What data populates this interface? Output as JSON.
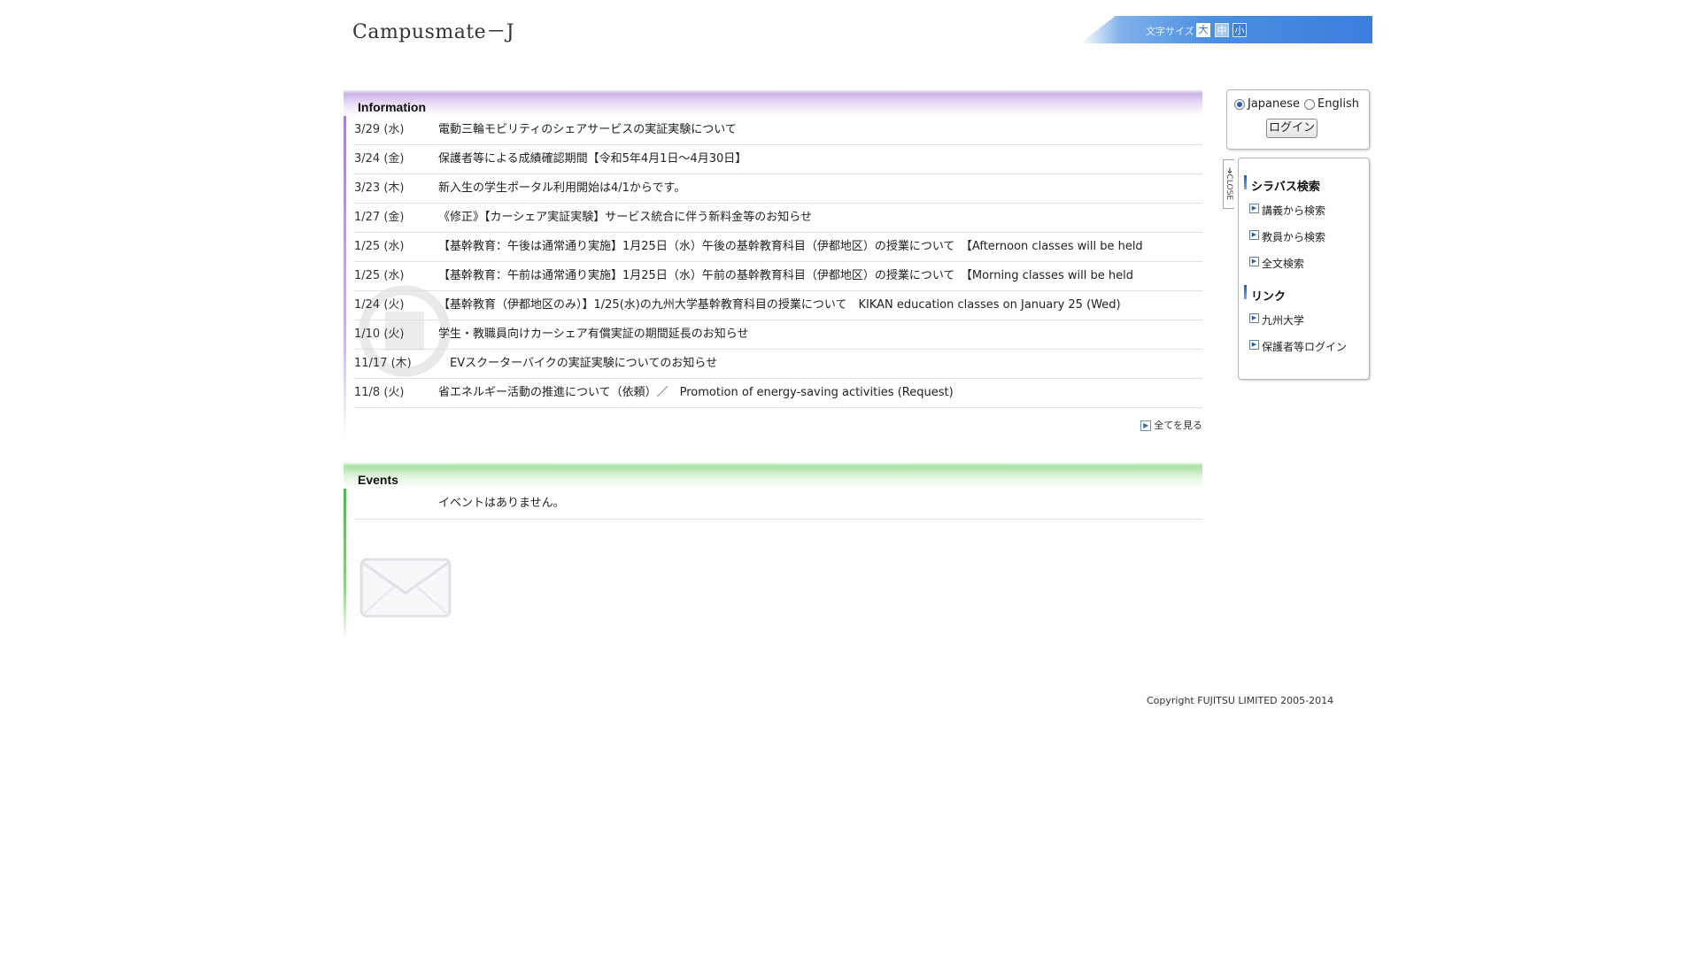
{
  "header": {
    "logo": "Campusmate－J",
    "font_size_label": "文字サイズ",
    "font_size_large": "大",
    "font_size_medium": "中",
    "font_size_small": "小"
  },
  "information": {
    "title": "Information",
    "items": [
      {
        "date": "3/29 (水)",
        "text": "電動三輪モビリティのシェアサービスの実証実験について"
      },
      {
        "date": "3/24 (金)",
        "text": "保護者等による成績確認期間【令和5年4月1日～4月30日】"
      },
      {
        "date": "3/23 (木)",
        "text": "新入生の学生ポータル利用開始は4/1からです。"
      },
      {
        "date": "1/27 (金)",
        "text": "《修正》【カーシェア実証実験】サービス統合に伴う新料金等のお知らせ"
      },
      {
        "date": "1/25 (水)",
        "text": "【基幹教育：午後は通常通り実施】1月25日（水）午後の基幹教育科目（伊都地区）の授業について　【Afternoon classes will be held"
      },
      {
        "date": "1/25 (水)",
        "text": "【基幹教育：午前は通常通り実施】1月25日（水）午前の基幹教育科目（伊都地区）の授業について　【Morning classes will be held"
      },
      {
        "date": "1/24 (火)",
        "text": "【基幹教育（伊都地区のみ）】1/25(水)の九州大学基幹教育科目の授業について　KIKAN education classes on January 25 (Wed)"
      },
      {
        "date": "1/10 (火)",
        "text": "学生・教職員向けカーシェア有償実証の期間延長のお知らせ"
      },
      {
        "date": "11/17 (木)",
        "text": "　EVスクーターバイクの実証実験についてのお知らせ"
      },
      {
        "date": "11/8 (火)",
        "text": "省エネルギー活動の推進について（依頼）／　Promotion of energy-saving activities (Request)"
      }
    ],
    "view_all": "全てを見る"
  },
  "events": {
    "title": "Events",
    "empty_message": "イベントはありません。"
  },
  "login": {
    "lang_japanese": "Japanese",
    "lang_english": "English",
    "selected_lang": "Japanese",
    "login_button": "ログイン"
  },
  "sidebar": {
    "close_label": "CLOSE",
    "syllabus_heading": "シラバス検索",
    "syllabus_links": [
      "講義から検索",
      "教員から検索",
      "全文検索"
    ],
    "links_heading": "リンク",
    "links": [
      "九州大学",
      "保護者等ログイン"
    ]
  },
  "footer": {
    "copyright": "Copyright FUJITSU LIMITED 2005-2014"
  }
}
